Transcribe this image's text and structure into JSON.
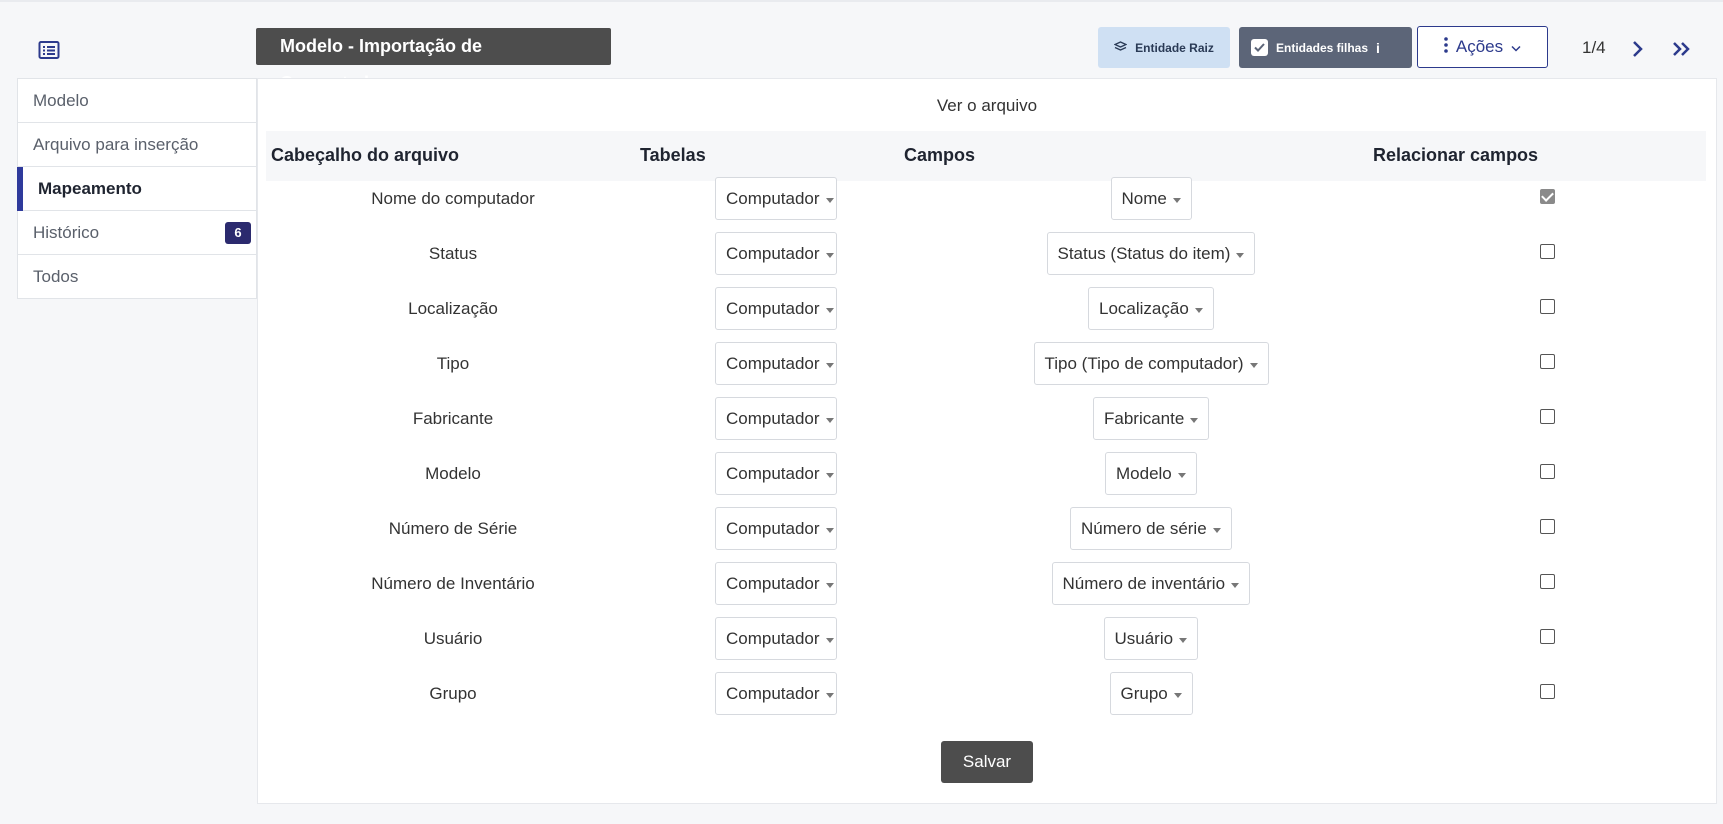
{
  "header": {
    "title": "Modelo - Importação de Computadores",
    "entity_root_label": "Entidade Raiz",
    "child_entities_label": "Entidades filhas",
    "actions_label": "Ações",
    "pager": "1/4",
    "icons": [
      "list-icon",
      "layers-icon",
      "info-icon",
      "kebab-icon",
      "chevron-down-icon",
      "chevron-right-icon",
      "double-chevron-right-icon"
    ]
  },
  "sidebar": {
    "items": [
      {
        "label": "Modelo"
      },
      {
        "label": "Arquivo para inserção"
      },
      {
        "label": "Mapeamento"
      },
      {
        "label": "Histórico",
        "badge": "6"
      },
      {
        "label": "Todos"
      }
    ]
  },
  "main": {
    "file_link": "Ver o arquivo",
    "columns": [
      "Cabeçalho do arquivo",
      "Tabelas",
      "Campos",
      "Relacionar campos"
    ],
    "rows": [
      {
        "header": "Nome do computador",
        "table": "Computador",
        "field": "Nome",
        "link": true
      },
      {
        "header": "Status",
        "table": "Computador",
        "field": "Status (Status do item)",
        "link": false
      },
      {
        "header": "Localização",
        "table": "Computador",
        "field": "Localização",
        "link": false
      },
      {
        "header": "Tipo",
        "table": "Computador",
        "field": "Tipo (Tipo de computador)",
        "link": false
      },
      {
        "header": "Fabricante",
        "table": "Computador",
        "field": "Fabricante",
        "link": false
      },
      {
        "header": "Modelo",
        "table": "Computador",
        "field": "Modelo",
        "link": false
      },
      {
        "header": "Número de Série",
        "table": "Computador",
        "field": "Número de série",
        "link": false
      },
      {
        "header": "Número de Inventário",
        "table": "Computador",
        "field": "Número de inventário",
        "link": false
      },
      {
        "header": "Usuário",
        "table": "Computador",
        "field": "Usuário",
        "link": false
      },
      {
        "header": "Grupo",
        "table": "Computador",
        "field": "Grupo",
        "link": false
      }
    ],
    "save_label": "Salvar"
  },
  "colors": {
    "accent": "#2f3a9c",
    "dark_button": "#4d4d4d",
    "badge": "#2b2a6e",
    "entity_root_bg": "#cfe0f3",
    "child_btn_bg": "#5c6578"
  }
}
